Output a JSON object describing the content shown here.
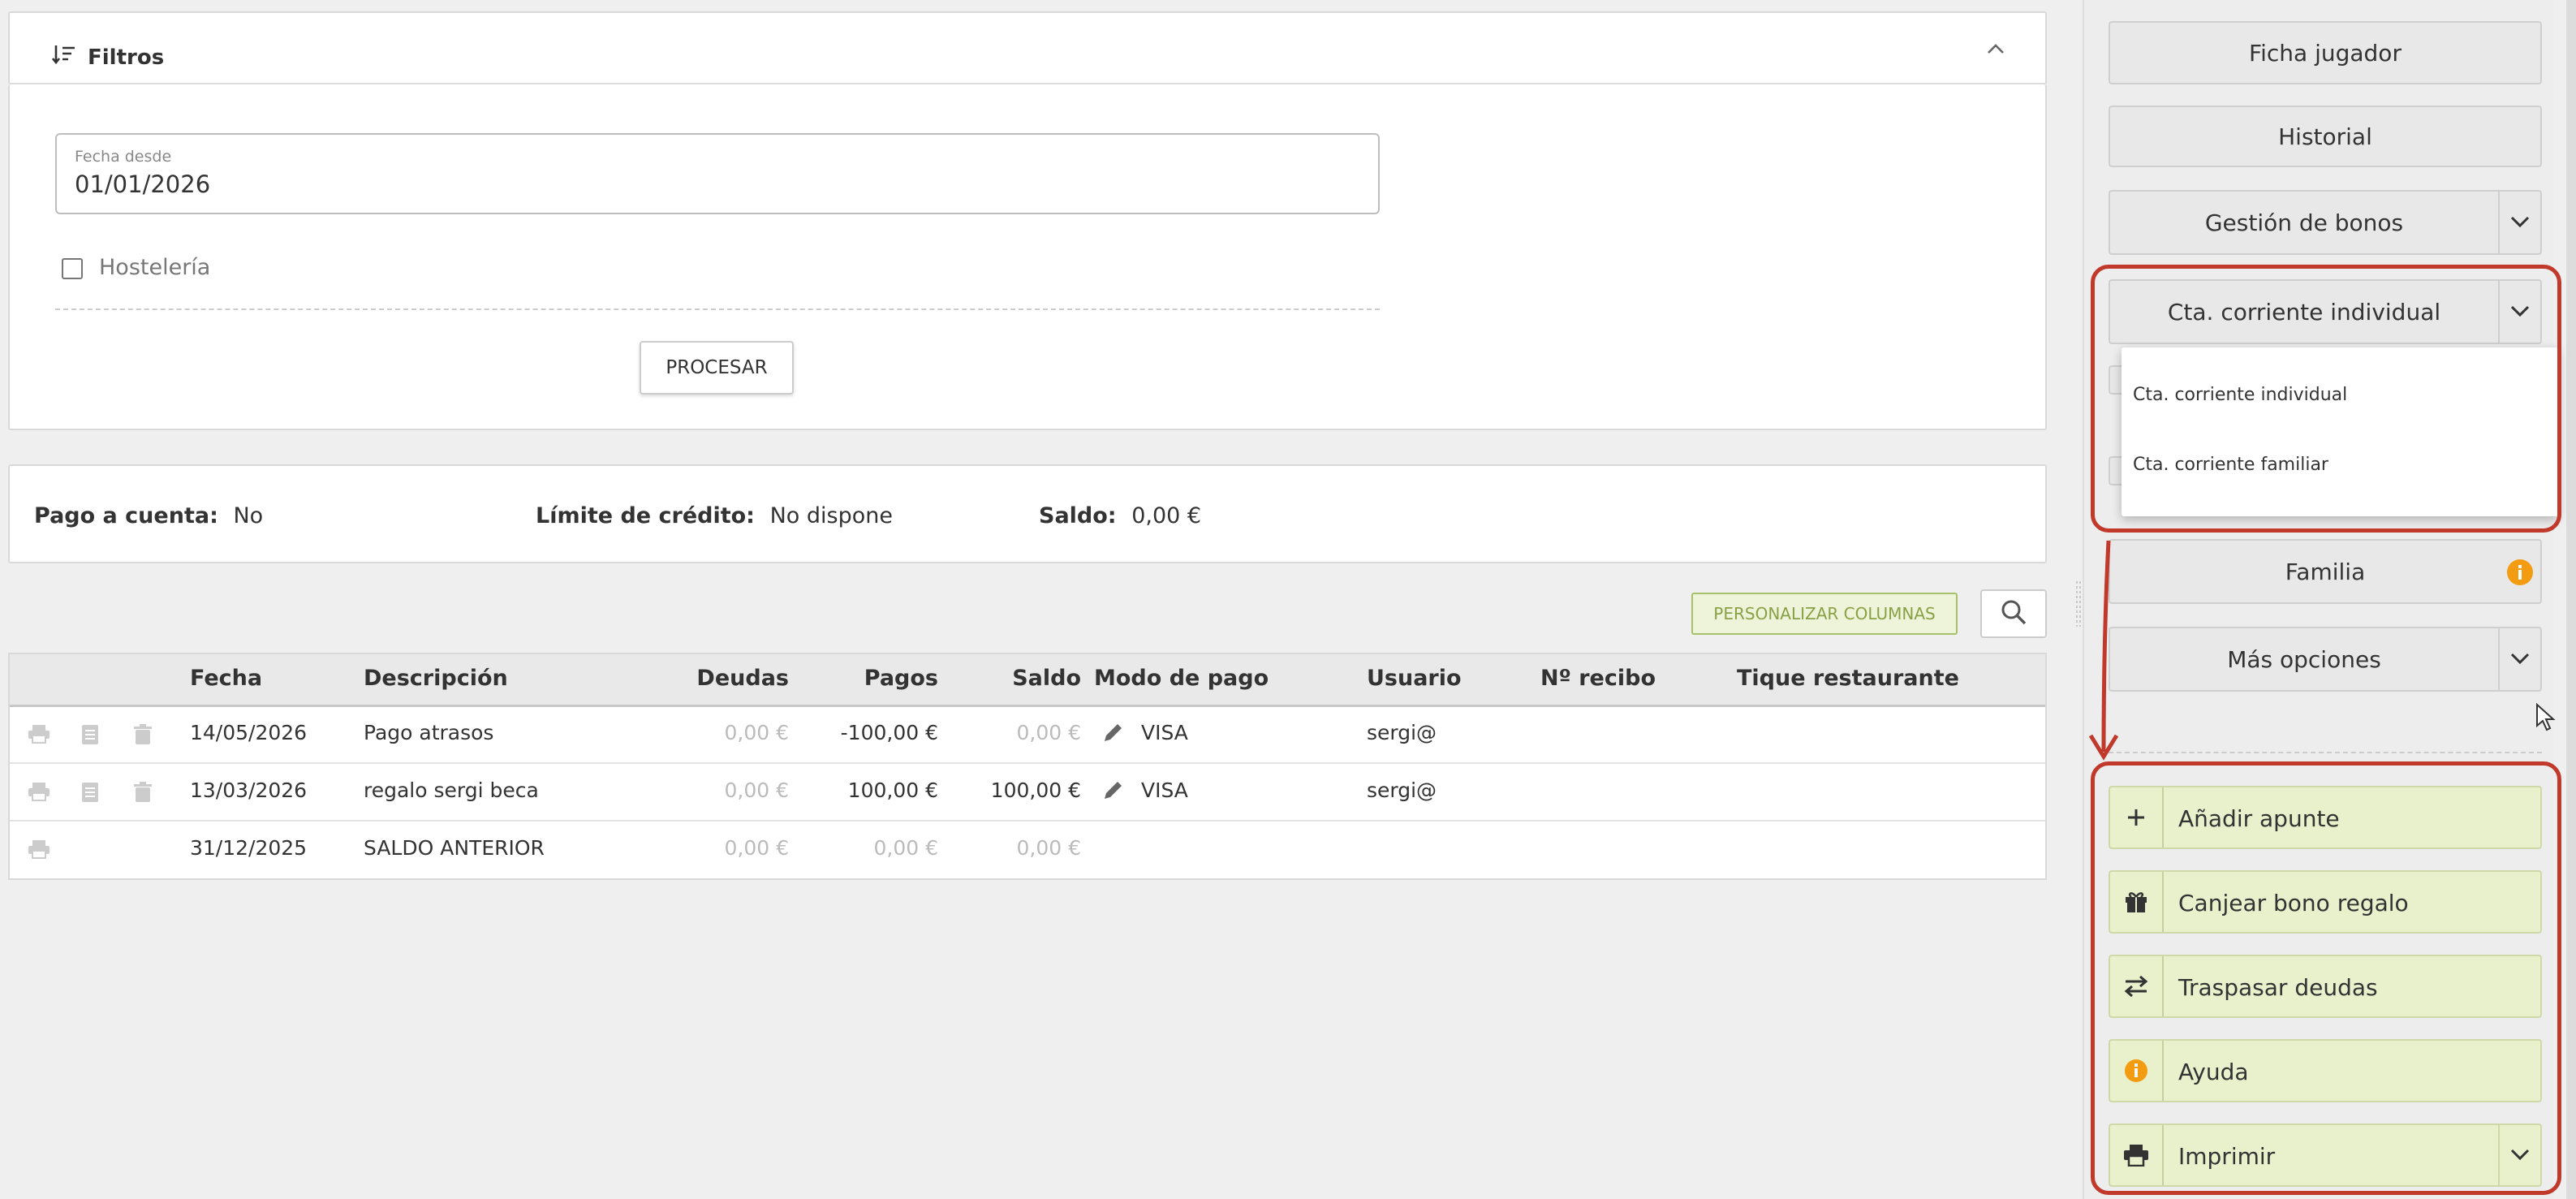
{
  "filters": {
    "title": "Filtros",
    "date_label": "Fecha desde",
    "date_value": "01/01/2026",
    "hosteleria_label": "Hostelería",
    "process_label": "PROCESAR"
  },
  "summary": {
    "pago_label": "Pago a cuenta:",
    "pago_value": "No",
    "limite_label": "Límite de crédito:",
    "limite_value": "No dispone",
    "saldo_label": "Saldo:",
    "saldo_value": "0,00 €"
  },
  "toolbar": {
    "personalizar_label": "PERSONALIZAR COLUMNAS"
  },
  "table": {
    "headers": [
      "Fecha",
      "Descripción",
      "Deudas",
      "Pagos",
      "Saldo",
      "Modo de pago",
      "Usuario",
      "Nº recibo",
      "Tique restaurante"
    ],
    "rows": [
      {
        "fecha": "14/05/2026",
        "descripcion": "Pago atrasos",
        "deudas": "0,00 €",
        "pagos": "-100,00 €",
        "saldo": "0,00 €",
        "modo": "VISA",
        "usuario": "sergi@"
      },
      {
        "fecha": "13/03/2026",
        "descripcion": "regalo sergi beca",
        "deudas": "0,00 €",
        "pagos": "100,00 €",
        "saldo": "100,00 €",
        "modo": "VISA",
        "usuario": "sergi@"
      },
      {
        "fecha": "31/12/2025",
        "descripcion": "SALDO ANTERIOR",
        "deudas": "0,00 €",
        "pagos": "0,00 €",
        "saldo": "0,00 €"
      }
    ]
  },
  "sidebar": {
    "ficha": "Ficha jugador",
    "historial": "Historial",
    "bonos": "Gestión de bonos",
    "cta": "Cta. corriente individual",
    "dropdown": [
      "Cta. corriente individual",
      "Cta. corriente familiar"
    ],
    "familia": "Familia",
    "mas": "Más opciones",
    "actions": {
      "anadir": "Añadir apunte",
      "canjear": "Canjear bono regalo",
      "traspasar": "Traspasar deudas",
      "ayuda": "Ayuda",
      "imprimir": "Imprimir"
    }
  },
  "colors": {
    "accent_red": "#c0392b",
    "action_green": "#e8f0cc",
    "info_orange": "#f39c12"
  }
}
